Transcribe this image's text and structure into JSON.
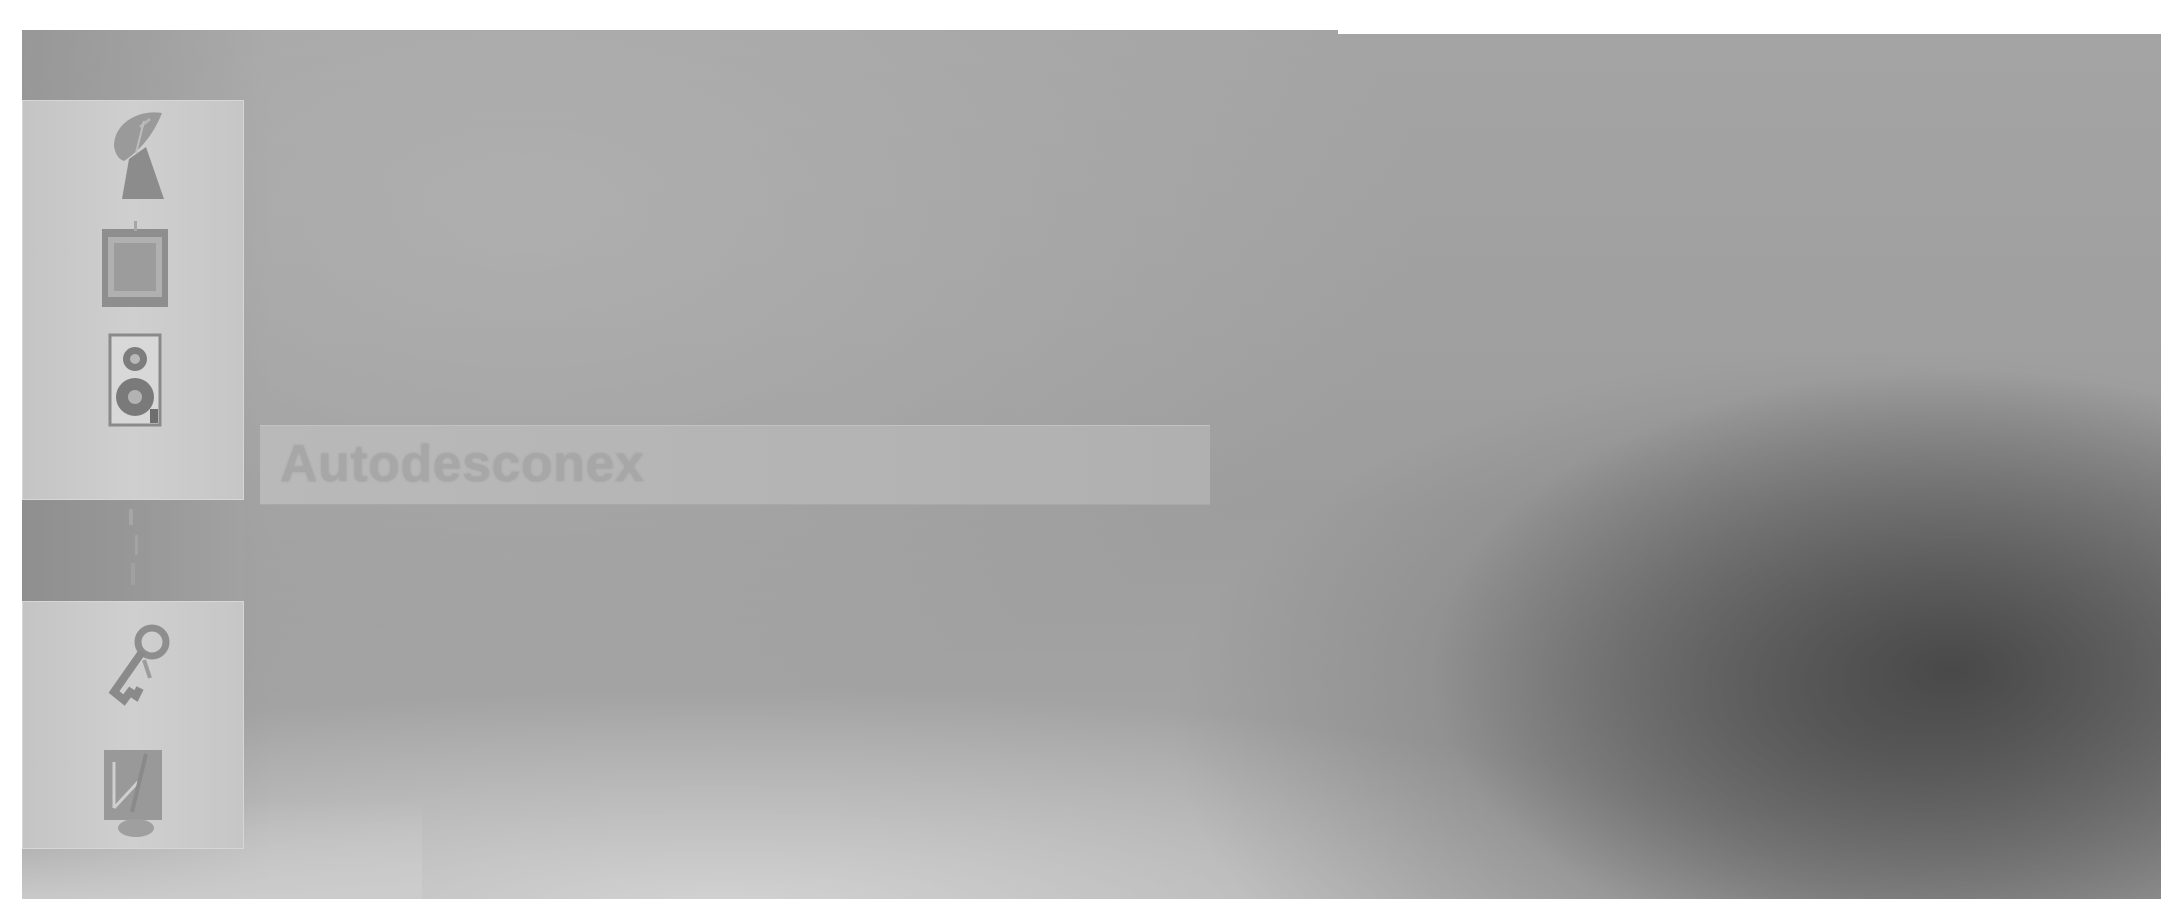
{
  "screen": {
    "background": "#ffffff",
    "panel_colors": {
      "base": "#a4a4a4",
      "dark_shadow": "#464646",
      "light_bottom": "#d7d7d7",
      "menu_block": "#c8c8c8",
      "active_item": "#939393",
      "selection_bar": "#b6b6b6"
    }
  },
  "sidebar": {
    "items": [
      {
        "id": "channel",
        "icon": "satellite-dish-icon",
        "active": false
      },
      {
        "id": "picture",
        "icon": "picture-screen-icon",
        "active": false
      },
      {
        "id": "sound",
        "icon": "speaker-icon",
        "active": false
      },
      {
        "id": "time",
        "icon": "clock-icon",
        "active": true
      },
      {
        "id": "option",
        "icon": "key-icon",
        "active": false
      },
      {
        "id": "lock",
        "icon": "lock-icon",
        "active": false
      }
    ]
  },
  "submenu": {
    "items": [
      {
        "label": "Autodesconex",
        "selected": true
      }
    ]
  }
}
